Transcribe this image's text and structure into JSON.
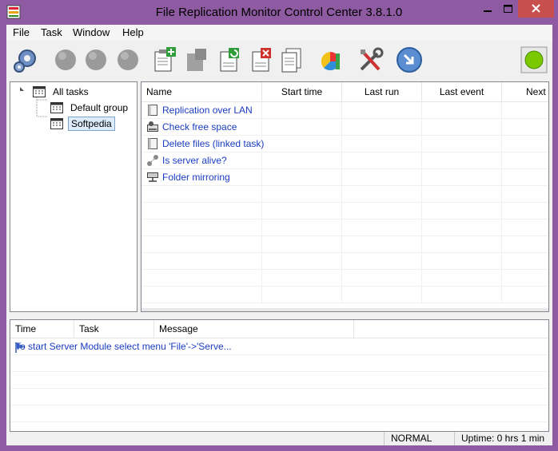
{
  "window": {
    "title": "File Replication Monitor Control Center 3.8.1.0",
    "colors": {
      "frame": "#8e5aa2",
      "close": "#c7504f",
      "link_text": "#1a3cc0",
      "status_light": "#7ac800"
    }
  },
  "menubar": [
    {
      "label": "File"
    },
    {
      "label": "Task"
    },
    {
      "label": "Window"
    },
    {
      "label": "Help"
    }
  ],
  "toolbar": {
    "buttons": [
      {
        "name": "settings-gears-icon"
      },
      {
        "name": "server-disabled-icon"
      },
      {
        "name": "server-disabled-icon"
      },
      {
        "name": "server-disabled-icon"
      },
      {
        "name": "new-task-icon"
      },
      {
        "name": "copy-task-icon"
      },
      {
        "name": "refresh-task-icon"
      },
      {
        "name": "delete-task-icon"
      },
      {
        "name": "documents-icon"
      },
      {
        "name": "statistics-chart-icon"
      },
      {
        "name": "tools-icon"
      },
      {
        "name": "go-arrow-icon"
      },
      {
        "name": "status-light-icon"
      }
    ]
  },
  "tree": {
    "root": "All tasks",
    "children": [
      "Default group",
      "Softpedia"
    ],
    "selected": "Softpedia"
  },
  "task_list": {
    "columns": [
      "Name",
      "Start time",
      "Last run",
      "Last event",
      "Next r"
    ],
    "rows": [
      {
        "name": "Replication over LAN",
        "icon": "document-icon"
      },
      {
        "name": "Check free space",
        "icon": "disk-icon"
      },
      {
        "name": "Delete files (linked task)",
        "icon": "document-icon"
      },
      {
        "name": "Is server alive?",
        "icon": "network-icon"
      },
      {
        "name": "Folder mirroring",
        "icon": "mirror-icon"
      }
    ]
  },
  "log": {
    "columns": [
      "Time",
      "Task",
      "Message"
    ],
    "rows": [
      {
        "icon": "flag-icon",
        "message": "To start Server Module select menu 'File'->'Serve..."
      }
    ]
  },
  "statusbar": {
    "mode": "NORMAL",
    "uptime": "Uptime: 0 hrs 1 min"
  }
}
